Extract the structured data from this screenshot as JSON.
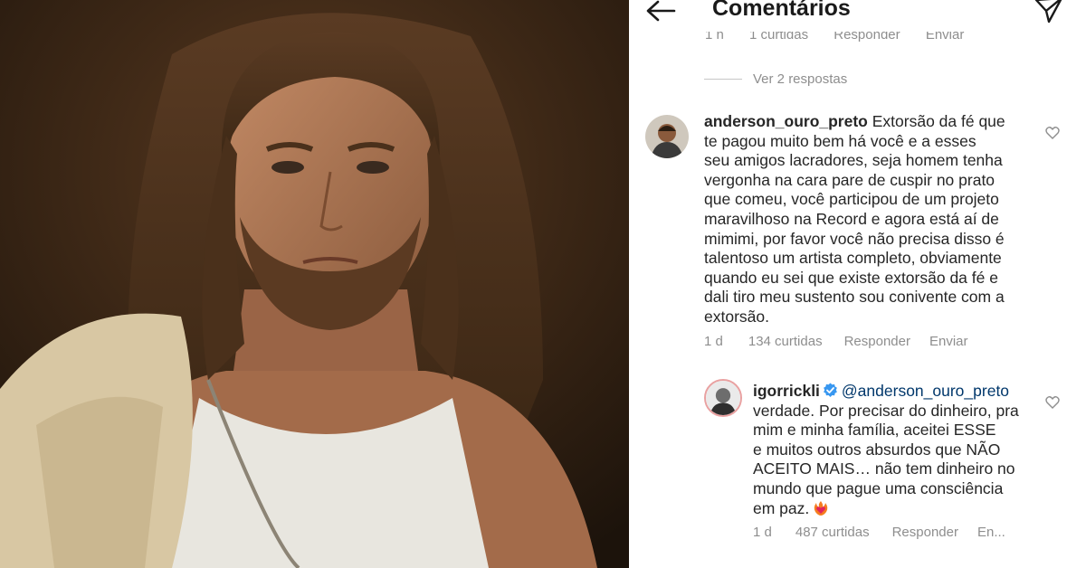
{
  "header": {
    "title": "Comentários",
    "back_icon": "arrow-left-icon",
    "send_icon": "paper-plane-icon"
  },
  "previous_comment_meta": {
    "time": "1 h",
    "likes": "1 curtidas",
    "reply": "Responder",
    "send": "Enviar"
  },
  "view_replies": "Ver 2 respostas",
  "comment": {
    "username": "anderson_ouro_preto",
    "lines": [
      " Extorsão da fé que",
      "te pagou muito bem há você e a esses",
      "seu amigos lacradores, seja homem tenha",
      "vergonha na cara pare de cuspir no prato",
      "que comeu, você participou de um projeto",
      "maravilhoso na Record e agora está aí de",
      "mimimi, por favor você não precisa disso é",
      "talentoso um artista completo, obviamente",
      "quando eu sei que existe extorsão da fé e",
      "dali tiro meu sustento sou conivente com a",
      "extorsão."
    ],
    "time": "1 d",
    "likes": "134 curtidas",
    "reply": "Responder",
    "send": "Enviar"
  },
  "reply": {
    "username": "igorrickli",
    "mention": "@anderson_ouro_preto",
    "lines": [
      "verdade. Por precisar do dinheiro, pra",
      "mim e minha família, aceitei ESSE",
      "e muitos outros absurdos que NÃO",
      "ACEITO MAIS… não tem dinheiro no",
      "mundo que pague uma consciência",
      "em paz."
    ],
    "emoji": "heart-on-fire-emoji",
    "time": "1 d",
    "likes": "487 curtidas",
    "reply": "Responder",
    "send": "En..."
  },
  "icons": {
    "like": "heart-outline-icon",
    "verified": "verified-badge-icon"
  },
  "colors": {
    "text": "#262626",
    "secondary": "#8e8e8e",
    "mention": "#00376b",
    "verified": "#3897f0"
  }
}
